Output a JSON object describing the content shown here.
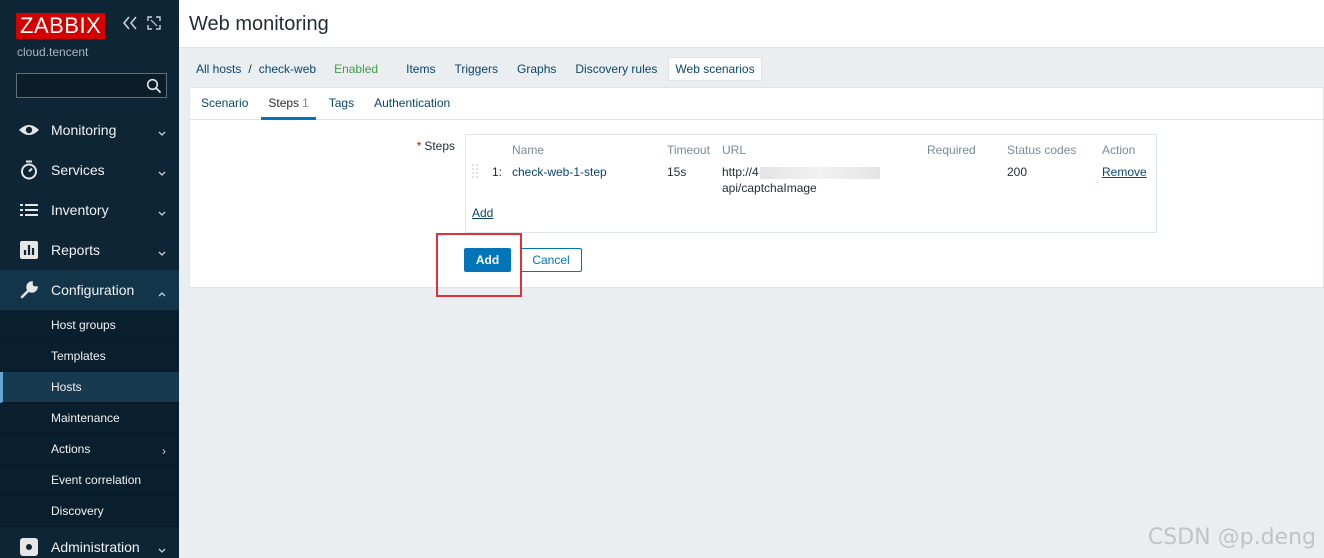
{
  "sidebar": {
    "logo": "ZABBIX",
    "server_name": "cloud.tencent",
    "search_placeholder": "",
    "menu": [
      {
        "label": "Monitoring"
      },
      {
        "label": "Services"
      },
      {
        "label": "Inventory"
      },
      {
        "label": "Reports"
      },
      {
        "label": "Configuration"
      }
    ],
    "submenu": [
      {
        "label": "Host groups"
      },
      {
        "label": "Templates"
      },
      {
        "label": "Hosts"
      },
      {
        "label": "Maintenance"
      },
      {
        "label": "Actions"
      },
      {
        "label": "Event correlation"
      },
      {
        "label": "Discovery"
      }
    ],
    "admin_label": "Administration"
  },
  "header": {
    "title": "Web monitoring"
  },
  "hostnav": {
    "all_hosts": "All hosts",
    "separator": "/",
    "host": "check-web",
    "status": "Enabled",
    "links": [
      "Items",
      "Triggers",
      "Graphs",
      "Discovery rules",
      "Web scenarios"
    ]
  },
  "tabs": [
    {
      "label": "Scenario"
    },
    {
      "label": "Steps",
      "count": "1"
    },
    {
      "label": "Tags"
    },
    {
      "label": "Authentication"
    }
  ],
  "form": {
    "steps_label": "Steps",
    "required_mark": "*",
    "columns": [
      "Name",
      "Timeout",
      "URL",
      "Required",
      "Status codes",
      "Action"
    ],
    "rows": [
      {
        "index": "1:",
        "name": "check-web-1-step",
        "timeout": "15s",
        "url_line1": "http://4",
        "url_line2": "api/captchaImage",
        "required": "",
        "status_codes": "200",
        "action": "Remove"
      }
    ],
    "add_step_link": "Add",
    "submit_label": "Add",
    "cancel_label": "Cancel"
  },
  "watermark": "CSDN @p.deng",
  "colors": {
    "sidebar_bg": "#0d2535",
    "logo_red": "#d40000",
    "primary_blue": "#0275b8",
    "link": "#0a466a",
    "enabled_green": "#429e47",
    "highlight_red": "#e0313a"
  }
}
